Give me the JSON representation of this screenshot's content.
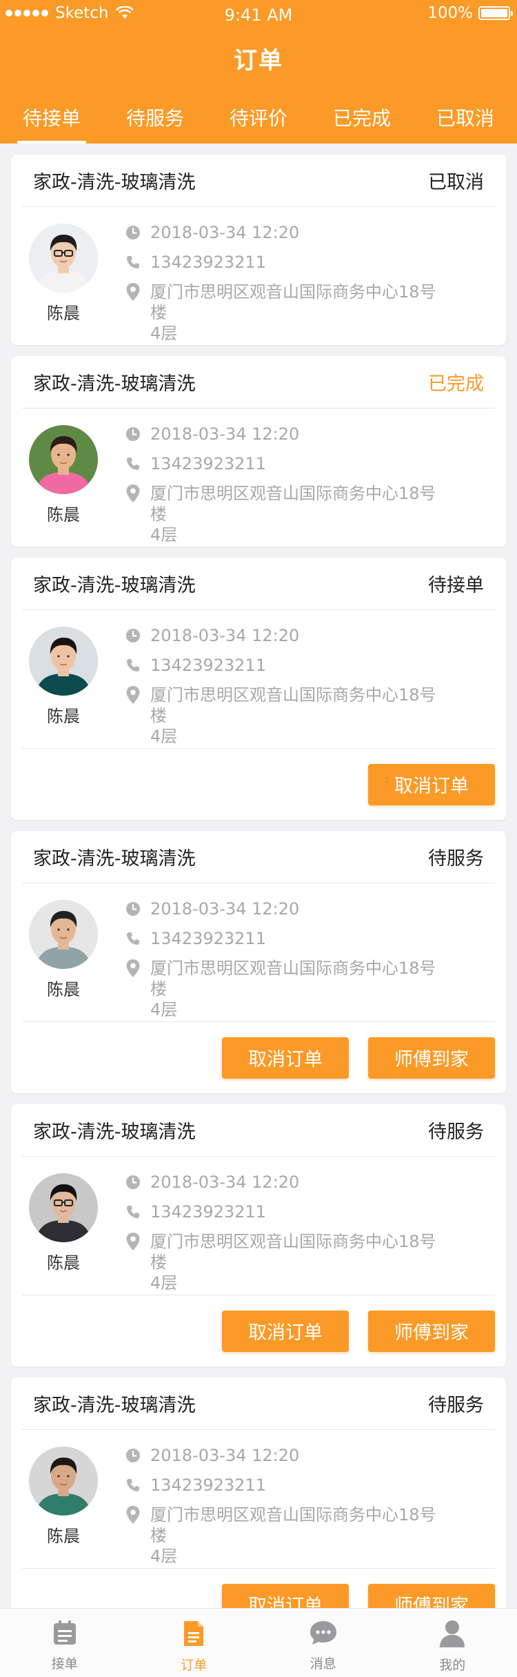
{
  "status_bar": {
    "carrier": "Sketch",
    "time": "9:41 AM",
    "battery": "100%"
  },
  "title": "订单",
  "tabs": [
    {
      "label": "待接单",
      "active": true
    },
    {
      "label": "待服务",
      "active": false
    },
    {
      "label": "待评价",
      "active": false
    },
    {
      "label": "已完成",
      "active": false
    },
    {
      "label": "已取消",
      "active": false
    }
  ],
  "orders": [
    {
      "service": "家政-清洗-玻璃清洗",
      "status": "已取消",
      "name": "陈晨",
      "time": "2018-03-34 12:20",
      "phone": "13423923211",
      "address_line1": "厦门市思明区观音山国际商务中心18号楼",
      "address_line2": "4层"
    },
    {
      "service": "家政-清洗-玻璃清洗",
      "status": "已完成",
      "name": "陈晨",
      "time": "2018-03-34 12:20",
      "phone": "13423923211",
      "address_line1": "厦门市思明区观音山国际商务中心18号楼",
      "address_line2": "4层"
    },
    {
      "service": "家政-清洗-玻璃清洗",
      "status": "待接单",
      "name": "陈晨",
      "time": "2018-03-34 12:20",
      "phone": "13423923211",
      "address_line1": "厦门市思明区观音山国际商务中心18号楼",
      "address_line2": "4层",
      "btn_cancel": "取消订单"
    },
    {
      "service": "家政-清洗-玻璃清洗",
      "status": "待服务",
      "name": "陈晨",
      "time": "2018-03-34 12:20",
      "phone": "13423923211",
      "address_line1": "厦门市思明区观音山国际商务中心18号楼",
      "address_line2": "4层",
      "btn_cancel": "取消订单",
      "btn_arrive": "师傅到家"
    },
    {
      "service": "家政-清洗-玻璃清洗",
      "status": "待服务",
      "name": "陈晨",
      "time": "2018-03-34 12:20",
      "phone": "13423923211",
      "address_line1": "厦门市思明区观音山国际商务中心18号楼",
      "address_line2": "4层",
      "btn_cancel": "取消订单",
      "btn_arrive": "师傅到家"
    },
    {
      "service": "家政-清洗-玻璃清洗",
      "status": "待服务",
      "name": "陈晨",
      "time": "2018-03-34 12:20",
      "phone": "13423923211",
      "address_line1": "厦门市思明区观音山国际商务中心18号楼",
      "address_line2": "4层",
      "btn_cancel": "取消订单",
      "btn_arrive": "师傅到家"
    }
  ],
  "bottom_nav": [
    {
      "label": "接单",
      "icon": "calendar-icon",
      "active": false
    },
    {
      "label": "订单",
      "icon": "document-icon",
      "active": true
    },
    {
      "label": "消息",
      "icon": "chat-icon",
      "active": false
    },
    {
      "label": "我的",
      "icon": "person-icon",
      "active": false
    }
  ],
  "colors": {
    "accent": "#fb9a26",
    "muted": "#a8a8ab",
    "background": "#f2f2f4"
  }
}
